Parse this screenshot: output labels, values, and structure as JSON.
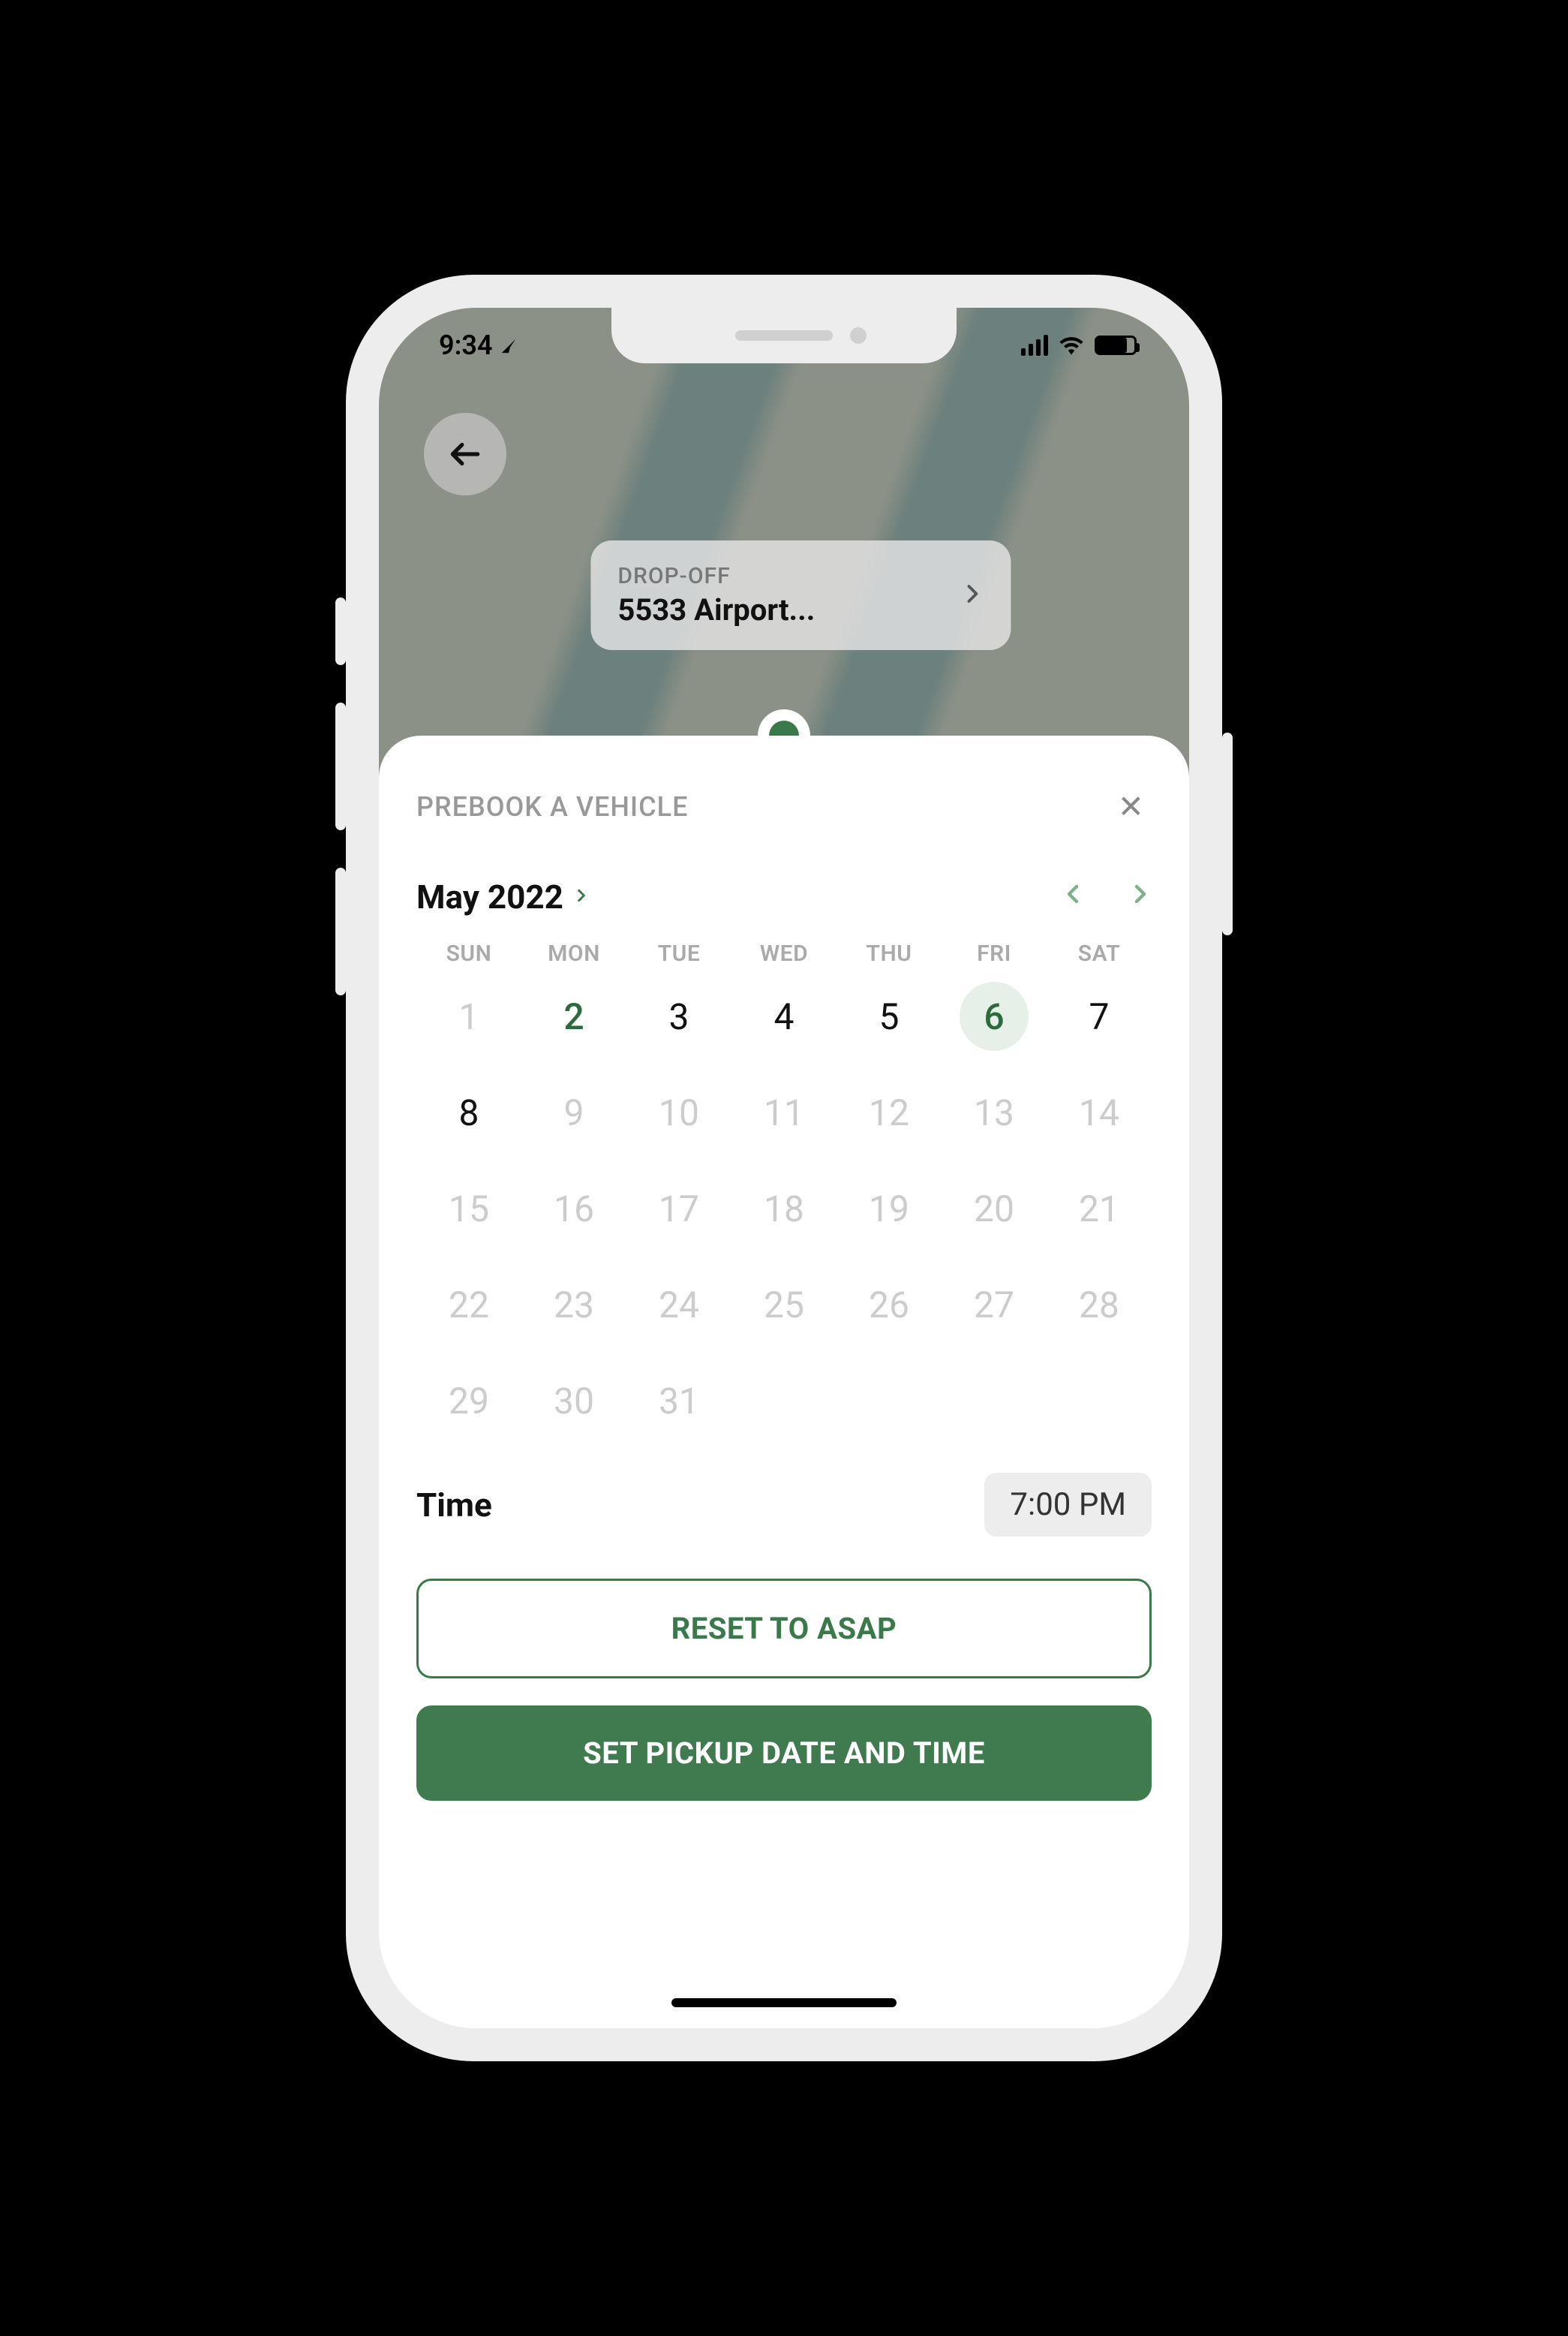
{
  "status_bar": {
    "time": "9:34",
    "location_active": true
  },
  "map": {
    "back_visible": true,
    "dropoff_label": "DROP-OFF",
    "dropoff_address": "5533 Airport..."
  },
  "sheet": {
    "title": "PREBOOK A VEHICLE",
    "close_label": "✕",
    "month_label": "May 2022",
    "day_headers": [
      "SUN",
      "MON",
      "TUE",
      "WED",
      "THU",
      "FRI",
      "SAT"
    ],
    "days": [
      {
        "n": "1",
        "state": "disabled"
      },
      {
        "n": "2",
        "state": "today"
      },
      {
        "n": "3",
        "state": "active"
      },
      {
        "n": "4",
        "state": "active"
      },
      {
        "n": "5",
        "state": "active"
      },
      {
        "n": "6",
        "state": "selected"
      },
      {
        "n": "7",
        "state": "active"
      },
      {
        "n": "8",
        "state": "active"
      },
      {
        "n": "9",
        "state": "disabled"
      },
      {
        "n": "10",
        "state": "disabled"
      },
      {
        "n": "11",
        "state": "disabled"
      },
      {
        "n": "12",
        "state": "disabled"
      },
      {
        "n": "13",
        "state": "disabled"
      },
      {
        "n": "14",
        "state": "disabled"
      },
      {
        "n": "15",
        "state": "disabled"
      },
      {
        "n": "16",
        "state": "disabled"
      },
      {
        "n": "17",
        "state": "disabled"
      },
      {
        "n": "18",
        "state": "disabled"
      },
      {
        "n": "19",
        "state": "disabled"
      },
      {
        "n": "20",
        "state": "disabled"
      },
      {
        "n": "21",
        "state": "disabled"
      },
      {
        "n": "22",
        "state": "disabled"
      },
      {
        "n": "23",
        "state": "disabled"
      },
      {
        "n": "24",
        "state": "disabled"
      },
      {
        "n": "25",
        "state": "disabled"
      },
      {
        "n": "26",
        "state": "disabled"
      },
      {
        "n": "27",
        "state": "disabled"
      },
      {
        "n": "28",
        "state": "disabled"
      },
      {
        "n": "29",
        "state": "disabled"
      },
      {
        "n": "30",
        "state": "disabled"
      },
      {
        "n": "31",
        "state": "disabled"
      }
    ],
    "time_label": "Time",
    "time_value": "7:00 PM",
    "reset_button": "RESET TO ASAP",
    "confirm_button": "SET PICKUP DATE AND TIME"
  }
}
